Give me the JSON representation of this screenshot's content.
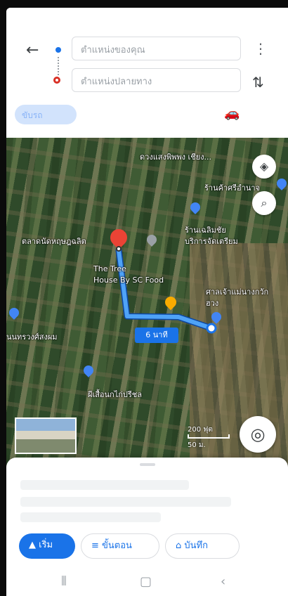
{
  "route": {
    "origin_placeholder": "ตำแหน่งของคุณ",
    "destination_placeholder": "ตำแหน่งปลายทาง",
    "chip_label": "ขับรถ",
    "back_icon": "arrow-left-icon",
    "more_icon": "more-vert-icon",
    "swap_icon": "swap-vert-icon",
    "mode_icon": "car-icon"
  },
  "map": {
    "labels": {
      "top_label": "ดวงแสงพิพพง เชียง...",
      "store": "ร้านค้าศรีอำนาจ",
      "restaurant_line1": "ร้านเฉลิมชัย",
      "restaurant_line2": "บริการจัดเตรียม",
      "left_place": "ตลาดนัดหฤษฎฉลิต",
      "tree_house_line1": "The Tree",
      "tree_house_line2": "House By SC Food",
      "right_place_line1": "ศาลเจ้าแม่นางกวัก",
      "right_place_line2": "ฮวง",
      "mid_left": "นนทรวงศ์สงผม",
      "bottom_place": "ผีเสื้อนกไก่ปรีชล",
      "route_duration": "6 นาที",
      "scale_top": "200 ฟุต",
      "scale_bottom": "50 ม."
    },
    "layers_icon": "layers-icon",
    "search_icon": "search-icon",
    "locate_icon": "my-location-icon",
    "route_color": "#4fa3f7"
  },
  "sheet": {
    "start_label": "▲ เริ่ม",
    "steps_label": "≡ ขั้นตอน",
    "save_label": "⌂ บันทึก"
  },
  "navbar": {
    "recent_icon": "recent-apps-icon",
    "home_icon": "home-icon",
    "back_icon": "back-icon"
  }
}
